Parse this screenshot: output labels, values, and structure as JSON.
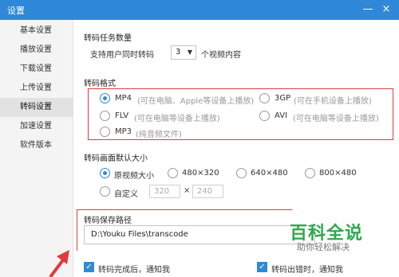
{
  "window": {
    "title": "设置",
    "minimize": "—",
    "close": "×"
  },
  "sidebar": {
    "items": [
      {
        "label": "基本设置"
      },
      {
        "label": "播放设置"
      },
      {
        "label": "下载设置"
      },
      {
        "label": "上传设置"
      },
      {
        "label": "转码设置",
        "active": true
      },
      {
        "label": "加速设置"
      },
      {
        "label": "软件版本"
      }
    ]
  },
  "task_count": {
    "title": "转码任务数量",
    "prefix": "支持用户同时转码",
    "value": "3",
    "suffix": "个视频内容"
  },
  "format": {
    "title": "转码格式",
    "options": [
      {
        "label": "MP4",
        "hint": "(可在电脑、Apple等设备上播放)",
        "checked": true
      },
      {
        "label": "3GP",
        "hint": "(可在手机设备上播放)",
        "checked": false
      },
      {
        "label": "FLV",
        "hint": "(可在电脑等设备上播放)",
        "checked": false
      },
      {
        "label": "AVI",
        "hint": "(可在电脑等设备上播放)",
        "checked": false
      },
      {
        "label": "MP3",
        "hint": "(纯音频文件)",
        "checked": false
      }
    ]
  },
  "resolution": {
    "title": "转码画面默认大小",
    "options": [
      {
        "label": "原视频大小",
        "checked": true
      },
      {
        "label": "480×320",
        "checked": false
      },
      {
        "label": "640×480",
        "checked": false
      },
      {
        "label": "800×480",
        "checked": false
      }
    ],
    "custom": {
      "label": "自定义",
      "width": "320",
      "height": "240",
      "times": "×",
      "checked": false
    }
  },
  "save_path": {
    "title": "转码保存路径",
    "value": "D:\\Youku Files\\transcode"
  },
  "notify": {
    "on_complete": {
      "label": "转码完成后，通知我",
      "checked": true
    },
    "on_error": {
      "label": "转码出错时，通知我",
      "checked": true
    }
  },
  "watermark": {
    "main": "百科全说",
    "sub": "助你轻松解决"
  },
  "colors": {
    "titlebar": "#2f89d8",
    "accent": "#2f89d8",
    "highlight": "#e03b3b",
    "watermark": "#2fa84f"
  }
}
